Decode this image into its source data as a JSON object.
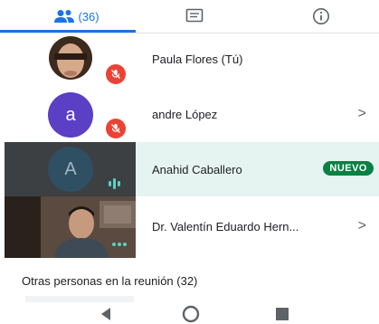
{
  "tabs": {
    "people_count": "(36)",
    "people_icon": "people-icon",
    "chat_icon": "chat-icon",
    "info_icon": "info-icon"
  },
  "participants": [
    {
      "name": "Paula Flores (Tú)",
      "muted": true,
      "kind": "photo"
    },
    {
      "name": "andre López",
      "muted": true,
      "kind": "initial",
      "initial": "a",
      "avatar_color": "#5b3fc4",
      "chevron": ">"
    },
    {
      "name": "Anahid Caballero",
      "kind": "initial",
      "initial": "A",
      "avatar_color": "#2f4f63",
      "badge": "NUEVO",
      "speaking": true
    },
    {
      "name": "Dr. Valentín Eduardo Hern...",
      "kind": "video",
      "chevron": ">"
    }
  ],
  "others": {
    "label": "Otras personas en la reunión (32)"
  },
  "colors": {
    "accent": "#1a73e8",
    "mute": "#ea4335",
    "new_badge": "#0b8043",
    "highlight_row": "#e6f4f1"
  }
}
